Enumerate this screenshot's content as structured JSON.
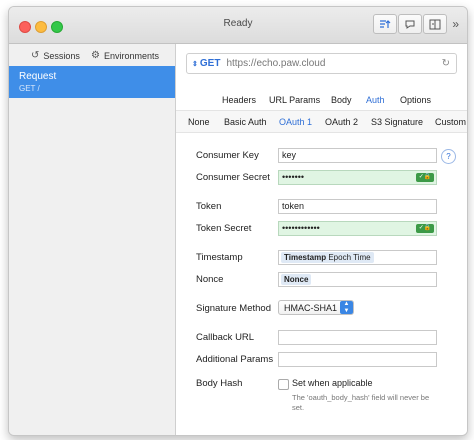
{
  "window": {
    "title": "Ready"
  },
  "sidebar": {
    "tabs": [
      {
        "label": "Sessions"
      },
      {
        "label": "Environments"
      }
    ],
    "request": {
      "name": "Request",
      "sub": "GET /"
    }
  },
  "urlbar": {
    "method": "GET",
    "url": "https://echo.paw.cloud"
  },
  "tabs": [
    "Headers",
    "URL Params",
    "Body",
    "Auth",
    "Options"
  ],
  "auth_tabs": [
    "None",
    "Basic Auth",
    "OAuth 1",
    "OAuth 2",
    "S3 Signature",
    "Custom"
  ],
  "form": {
    "consumer_key": {
      "label": "Consumer Key",
      "value": "key"
    },
    "consumer_secret": {
      "label": "Consumer Secret",
      "value": "•••••••"
    },
    "token": {
      "label": "Token",
      "value": "token"
    },
    "token_secret": {
      "label": "Token Secret",
      "value": "••••••••••••"
    },
    "timestamp": {
      "label": "Timestamp",
      "token": "Timestamp",
      "token_sub": "Epoch Time"
    },
    "nonce": {
      "label": "Nonce",
      "token": "Nonce"
    },
    "signature_method": {
      "label": "Signature Method",
      "value": "HMAC-SHA1"
    },
    "callback_url": {
      "label": "Callback URL",
      "value": ""
    },
    "additional_params": {
      "label": "Additional Params",
      "value": ""
    },
    "body_hash": {
      "label": "Body Hash",
      "checkbox": "Set when applicable",
      "hint": "The 'oauth_body_hash' field will never be set."
    },
    "help": "?"
  },
  "colors": {
    "accent": "#2f6fd6",
    "selection": "#3f8ee8",
    "secure_field": "#e0f5e3"
  }
}
